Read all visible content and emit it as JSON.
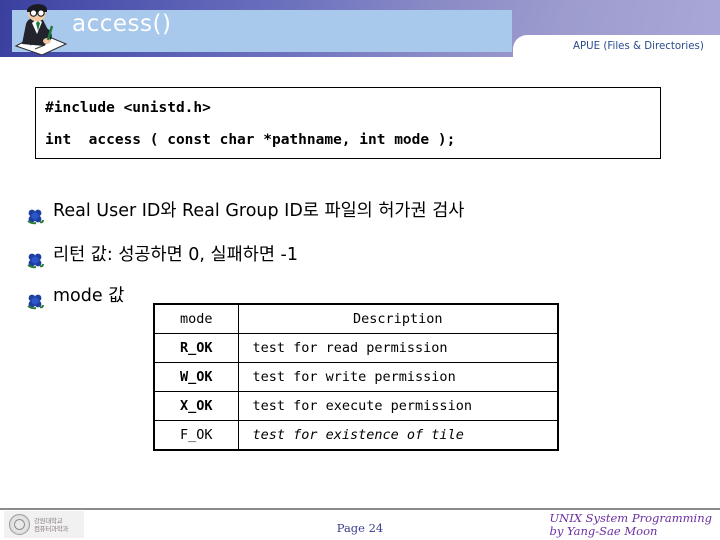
{
  "header": {
    "title": "access()",
    "subject_label": "APUE (Files & Directories)",
    "icon": "person-writing-icon",
    "band_color_start": "#3a3f9e",
    "band_color_end": "#a9a7d6",
    "title_bar_color": "#a8c8ec"
  },
  "code_box": {
    "line1": "#include <unistd.h>",
    "line2": "int  access ( const char *pathname, int mode );"
  },
  "bullets": [
    {
      "icon": "flower-bullet-icon",
      "text": "Real User ID와 Real Group ID로 파일의 허가권 검사"
    },
    {
      "icon": "flower-bullet-icon",
      "text": "리턴 값: 성공하면 0, 실패하면 -1"
    },
    {
      "icon": "flower-bullet-icon",
      "text": "mode 값"
    }
  ],
  "mode_table": {
    "columns": [
      "mode",
      "Description"
    ],
    "rows": [
      {
        "mode": "R_OK",
        "description": "test for read permission"
      },
      {
        "mode": "W_OK",
        "description": "test for write permission"
      },
      {
        "mode": "X_OK",
        "description": "test for execute permission"
      },
      {
        "mode": "F_OK",
        "description": "test for existence of tile"
      }
    ]
  },
  "footer": {
    "logo_line1": "강원대학교",
    "logo_line2": "컴퓨터과학과",
    "page": "Page 24",
    "course_line1": "UNIX System Programming",
    "course_line2": "by Yang-Sae Moon"
  }
}
